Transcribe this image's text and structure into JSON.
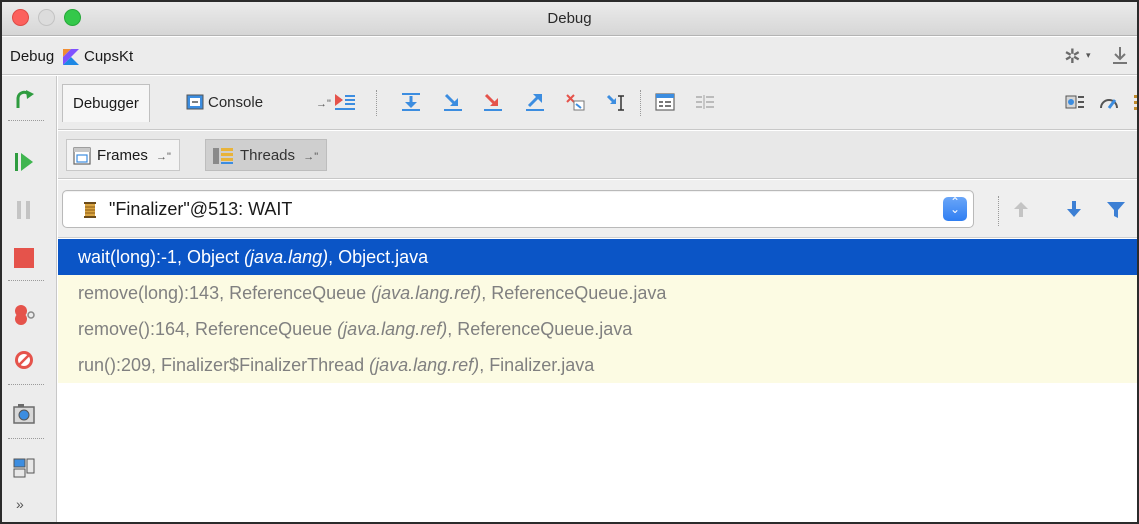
{
  "window": {
    "title": "Debug"
  },
  "session": {
    "label": "Debug",
    "config_name": "CupsKt",
    "icons": [
      "kotlin-icon",
      "gear-icon",
      "download-icon"
    ]
  },
  "left_toolbar": {
    "icons": [
      "rerun-icon",
      "resume-icon",
      "pause-icon",
      "stop-icon",
      "view-breakpoints-icon",
      "mute-breakpoints-icon",
      "camera-icon",
      "layout-icon",
      "more-icon"
    ],
    "more_label": "»"
  },
  "tabs": {
    "debugger": "Debugger",
    "console": "Console",
    "pin_glyph": "→\""
  },
  "subtabs": {
    "frames": "Frames",
    "threads": "Threads",
    "pin_glyph": "→\""
  },
  "thread_selector": {
    "value": "\"Finalizer\"@513: WAIT"
  },
  "frames": [
    {
      "method": "wait(long):-1, Object ",
      "package": "(java.lang)",
      "file": ", Object.java",
      "state": "selected"
    },
    {
      "method": "remove(long):143, ReferenceQueue ",
      "package": "(java.lang.ref)",
      "file": ", ReferenceQueue.java",
      "state": "library"
    },
    {
      "method": "remove():164, ReferenceQueue ",
      "package": "(java.lang.ref)",
      "file": ", ReferenceQueue.java",
      "state": "library"
    },
    {
      "method": "run():209, Finalizer$FinalizerThread ",
      "package": "(java.lang.ref)",
      "file": ", Finalizer.java",
      "state": "library"
    }
  ],
  "colors": {
    "selection": "#0b55c6",
    "library_row_bg": "#fcfbe3",
    "library_row_text": "#808080",
    "accent_blue": "#2f7ef2"
  }
}
